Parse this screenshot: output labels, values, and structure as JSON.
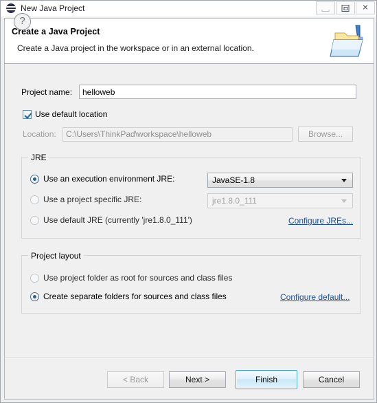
{
  "window": {
    "title": "New Java Project",
    "app_icon": "eclipse-icon",
    "controls": {
      "minimize": "minimize-button",
      "maximize": "maximize-button",
      "close": "✕"
    }
  },
  "banner": {
    "title": "Create a Java Project",
    "description": "Create a Java project in the workspace or in an external location.",
    "icon": "java-project-folder-icon"
  },
  "form": {
    "project_name_label": "Project name:",
    "project_name_value": "helloweb",
    "project_name_placeholder": "",
    "use_default_location_label": "Use default location",
    "use_default_location_checked": true,
    "location_label": "Location:",
    "location_value": "C:\\Users\\ThinkPad\\workspace\\helloweb",
    "location_enabled": false,
    "browse_label": "Browse..."
  },
  "jre_group": {
    "title": "JRE",
    "options": [
      {
        "label": "Use an execution environment JRE:",
        "selected": true,
        "combo_value": "JavaSE-1.8",
        "combo_enabled": true
      },
      {
        "label": "Use a project specific JRE:",
        "selected": false,
        "combo_value": "jre1.8.0_111",
        "combo_enabled": false
      },
      {
        "label": "Use default JRE (currently 'jre1.8.0_111')",
        "selected": false
      }
    ],
    "configure_link": "Configure JREs..."
  },
  "layout_group": {
    "title": "Project layout",
    "options": [
      {
        "label": "Use project folder as root for sources and class files",
        "selected": false
      },
      {
        "label": "Create separate folders for sources and class files",
        "selected": true
      }
    ],
    "configure_link": "Configure default..."
  },
  "footer": {
    "help_glyph": "?",
    "back_label": "< Back",
    "back_enabled": false,
    "next_label": "Next >",
    "finish_label": "Finish",
    "cancel_label": "Cancel"
  },
  "colors": {
    "dialog_bg": "#f0f0f0",
    "banner_bg": "#ffffff",
    "link": "#1b4f9c",
    "default_button_border": "#3c9fd4",
    "radio_dot": "#2e5f86",
    "checkbox_check": "#1e5f9e"
  }
}
